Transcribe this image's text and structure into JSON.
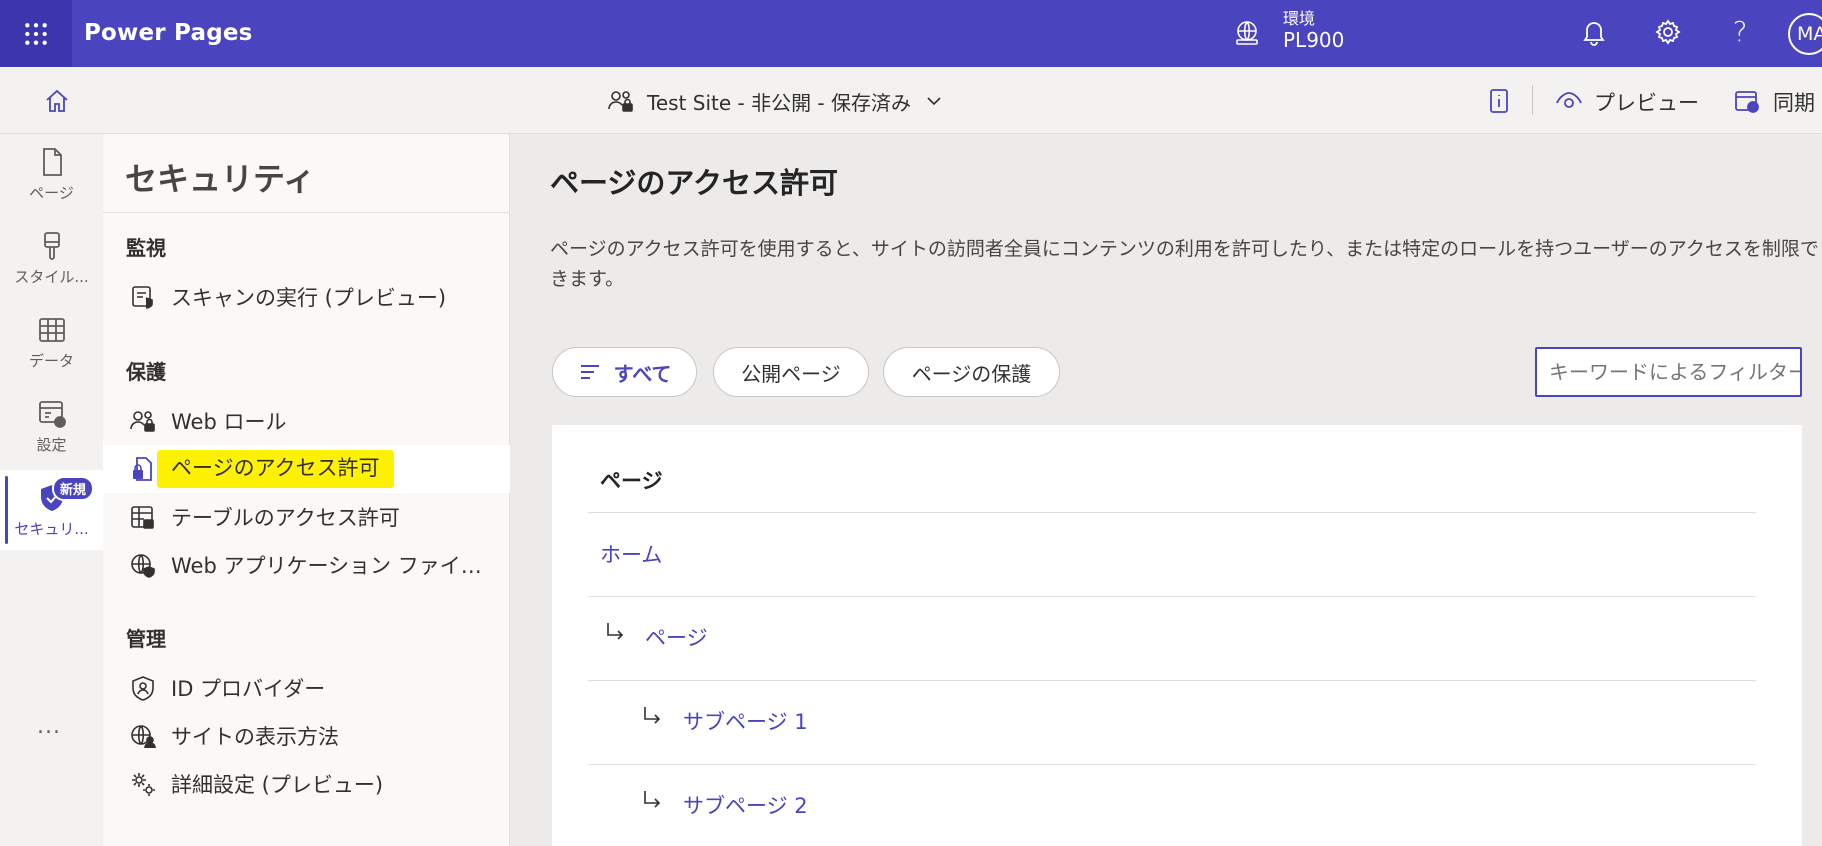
{
  "topbar": {
    "app_title": "Power Pages",
    "env_label": "環境",
    "env_value": "PL900",
    "avatar": "MA",
    "help": "?",
    "icons": [
      "waffle-icon",
      "environment-icon",
      "bell-icon",
      "gear-icon",
      "help-icon"
    ]
  },
  "cmdbar": {
    "site_status": "Test Site - 非公開 - 保存済み",
    "preview_label": "プレビュー",
    "sync_label": "同期"
  },
  "rail": {
    "items": [
      {
        "label": "ページ",
        "icon": "page-icon"
      },
      {
        "label": "スタイル...",
        "icon": "brush-icon"
      },
      {
        "label": "データ",
        "icon": "table-icon"
      },
      {
        "label": "設定",
        "icon": "settings-icon"
      },
      {
        "label": "セキュリ...",
        "icon": "shield-icon",
        "badge": "新規",
        "active": true
      }
    ],
    "more": "..."
  },
  "panel": {
    "title": "セキュリティ",
    "sections": [
      {
        "heading": "監視",
        "items": [
          {
            "label": "スキャンの実行 (プレビュー)",
            "icon": "scan-icon"
          }
        ]
      },
      {
        "heading": "保護",
        "items": [
          {
            "label": "Web ロール",
            "icon": "web-roles-icon"
          },
          {
            "label": "ページのアクセス許可",
            "icon": "page-lock-icon",
            "active": true
          },
          {
            "label": "テーブルのアクセス許可",
            "icon": "table-lock-icon"
          },
          {
            "label": "Web アプリケーション ファイア...",
            "icon": "globe-shield-icon"
          }
        ]
      },
      {
        "heading": "管理",
        "items": [
          {
            "label": "ID プロバイダー",
            "icon": "id-provider-icon"
          },
          {
            "label": "サイトの表示方法",
            "icon": "globe-person-icon"
          },
          {
            "label": "詳細設定 (プレビュー)",
            "icon": "advanced-settings-icon"
          }
        ]
      }
    ]
  },
  "main": {
    "title": "ページのアクセス許可",
    "description": "ページのアクセス許可を使用すると、サイトの訪問者全員にコンテンツの利用を許可したり、または特定のロールを持つユーザーのアクセスを制限できます。",
    "filters": [
      "すべて",
      "公開ページ",
      "ページの保護"
    ],
    "active_filter": "すべて",
    "search_placeholder": "キーワードによるフィルター",
    "column_header": "ページ",
    "rows": [
      {
        "label": "ホーム",
        "level": 0
      },
      {
        "label": "ページ",
        "level": 1
      },
      {
        "label": "サブページ 1",
        "level": 2
      },
      {
        "label": "サブページ 2",
        "level": 2
      }
    ]
  },
  "colors": {
    "brand": "#4b44bf",
    "highlight": "#fff200",
    "link": "#4b44bf"
  }
}
